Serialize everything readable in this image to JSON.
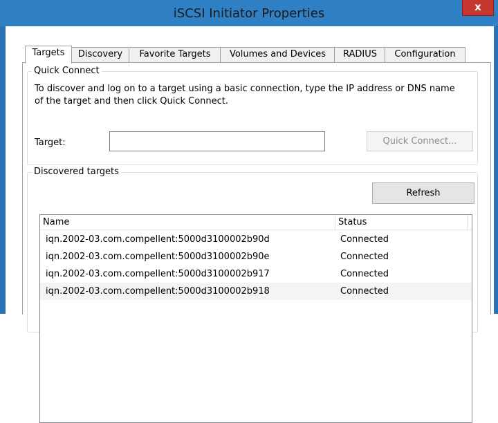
{
  "window": {
    "title": "iSCSI Initiator Properties",
    "close_label": "x"
  },
  "tabs": [
    {
      "label": "Targets"
    },
    {
      "label": "Discovery"
    },
    {
      "label": "Favorite Targets"
    },
    {
      "label": "Volumes and Devices"
    },
    {
      "label": "RADIUS"
    },
    {
      "label": "Configuration"
    }
  ],
  "quick_connect": {
    "group_label": "Quick Connect",
    "description": "To discover and log on to a target using a basic connection, type the IP address or DNS name of the target and then click Quick Connect.",
    "target_label": "Target:",
    "target_value": "",
    "button_label": "Quick Connect..."
  },
  "discovered": {
    "group_label": "Discovered targets",
    "refresh_label": "Refresh",
    "columns": {
      "name": "Name",
      "status": "Status"
    },
    "rows": [
      {
        "name": "iqn.2002-03.com.compellent:5000d3100002b90d",
        "status": "Connected"
      },
      {
        "name": "iqn.2002-03.com.compellent:5000d3100002b90e",
        "status": "Connected"
      },
      {
        "name": "iqn.2002-03.com.compellent:5000d3100002b917",
        "status": "Connected"
      },
      {
        "name": "iqn.2002-03.com.compellent:5000d3100002b918",
        "status": "Connected"
      }
    ]
  },
  "colors": {
    "title_bar": "#2f80c4",
    "close_button": "#c7372f"
  }
}
